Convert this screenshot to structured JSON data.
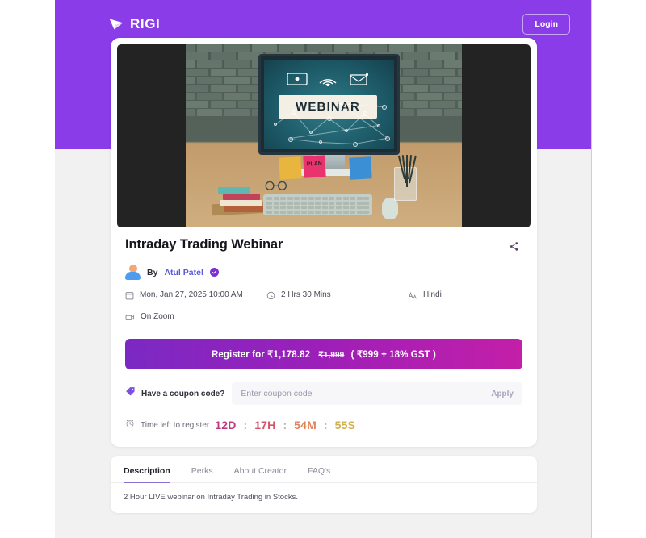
{
  "header": {
    "brand_name": "RIGI",
    "brand_icon": "rigi-play-logo-icon",
    "login_label": "Login"
  },
  "hero": {
    "screen_text": "WEBINAR",
    "sticky_note_pink": "PLAN",
    "alt": "desk with monitor displaying webinar graphic"
  },
  "event": {
    "title": "Intraday Trading Webinar",
    "by_prefix": "By",
    "author": "Atul Patel",
    "verified_icon": "verified-check-icon",
    "share_icon": "share-icon",
    "meta": {
      "date_icon": "calendar-icon",
      "date": "Mon, Jan 27, 2025 10:00 AM",
      "duration_icon": "clock-icon",
      "duration": "2 Hrs 30 Mins",
      "language_icon": "translate-icon",
      "language": "Hindi",
      "platform_icon": "video-camera-icon",
      "platform": "On Zoom"
    }
  },
  "register": {
    "label_prefix": "Register for",
    "price": "₹1,178.82",
    "old_price": "₹1,999",
    "breakdown": "( ₹999 + 18% GST )"
  },
  "coupon": {
    "icon": "coupon-tag-icon",
    "label": "Have a coupon code?",
    "placeholder": "Enter coupon code",
    "value": "",
    "apply_label": "Apply"
  },
  "countdown": {
    "icon": "alarm-clock-icon",
    "label": "Time left to register",
    "days": "12D",
    "hours": "17H",
    "minutes": "54M",
    "seconds": "55S",
    "separator": ":",
    "colors": {
      "days": "#c0397f",
      "hours": "#d4546a",
      "minutes": "#dd8257",
      "seconds": "#d2b04a"
    }
  },
  "tabs": {
    "items": [
      {
        "label": "Description"
      },
      {
        "label": "Perks"
      },
      {
        "label": "About Creator"
      },
      {
        "label": "FAQ's"
      }
    ],
    "active_index": 0,
    "body_text": "2 Hour LIVE webinar on Intraday Trading in Stocks."
  },
  "theme": {
    "brand_purple": "#8a3ce8",
    "page_bg": "#f1f1f2",
    "cta_gradient_start": "#7b29c4",
    "cta_gradient_end": "#c41fa8",
    "link_blue": "#5a5ad8",
    "tab_underline": "#8a6fd6"
  }
}
